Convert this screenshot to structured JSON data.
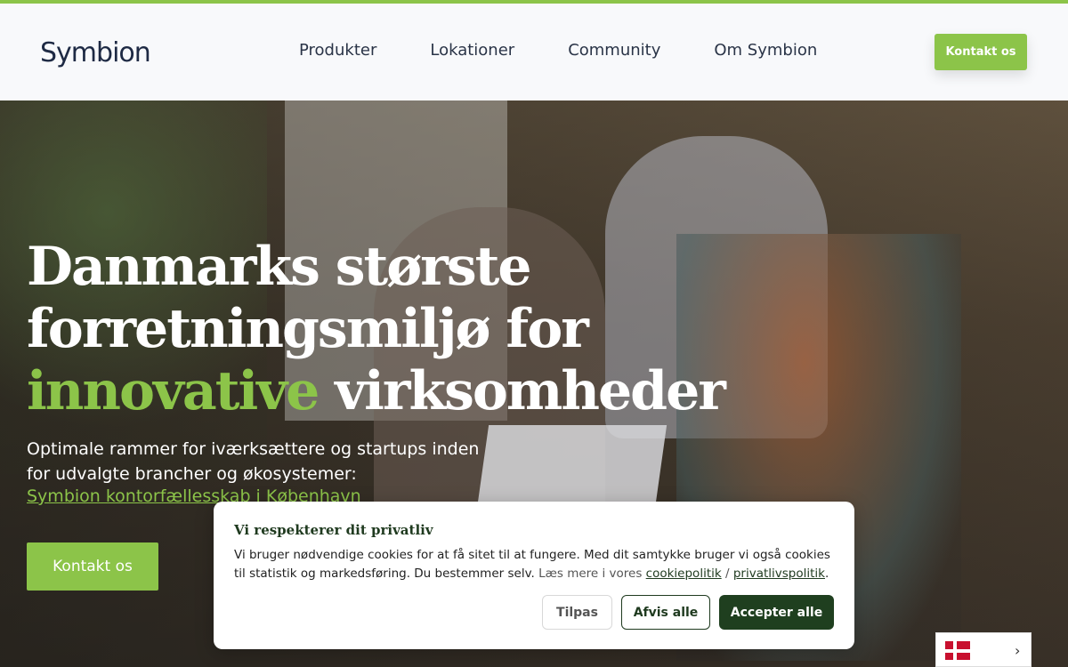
{
  "header": {
    "logo": "Symbion",
    "nav": [
      "Produkter",
      "Lokationer",
      "Community",
      "Om Symbion"
    ],
    "cta": "Kontakt os"
  },
  "hero": {
    "title_line1": "Danmarks største",
    "title_line2": "forretningsmiljø for",
    "title_accent": "innovative",
    "title_rest": " virksomheder",
    "subtitle": "Optimale rammer for iværksættere og startups inden for udvalgte brancher og økosystemer:",
    "link": "Symbion kontorfællesskab i København",
    "cta": "Kontakt os"
  },
  "cookie": {
    "title": "Vi respekterer dit privatliv",
    "text_main": "Vi bruger nødvendige cookies for at få sitet til at fungere. Med dit samtykke bruger vi også cookies til statistik og markedsføring. Du bestemmer selv.",
    "text_more": " Læs mere i vores ",
    "link_cookie": "cookiepolitik",
    "separator": " / ",
    "link_privacy": "privatlivspolitik",
    "end": ".",
    "btn_customize": "Tilpas",
    "btn_reject": "Afvis alle",
    "btn_accept": "Accepter alle"
  },
  "language": {
    "flag_icon": "denmark-flag-icon",
    "chevron": "›"
  },
  "colors": {
    "accent": "#8cc449",
    "dark_green": "#1f3f1f",
    "navy": "#1e2a44"
  }
}
